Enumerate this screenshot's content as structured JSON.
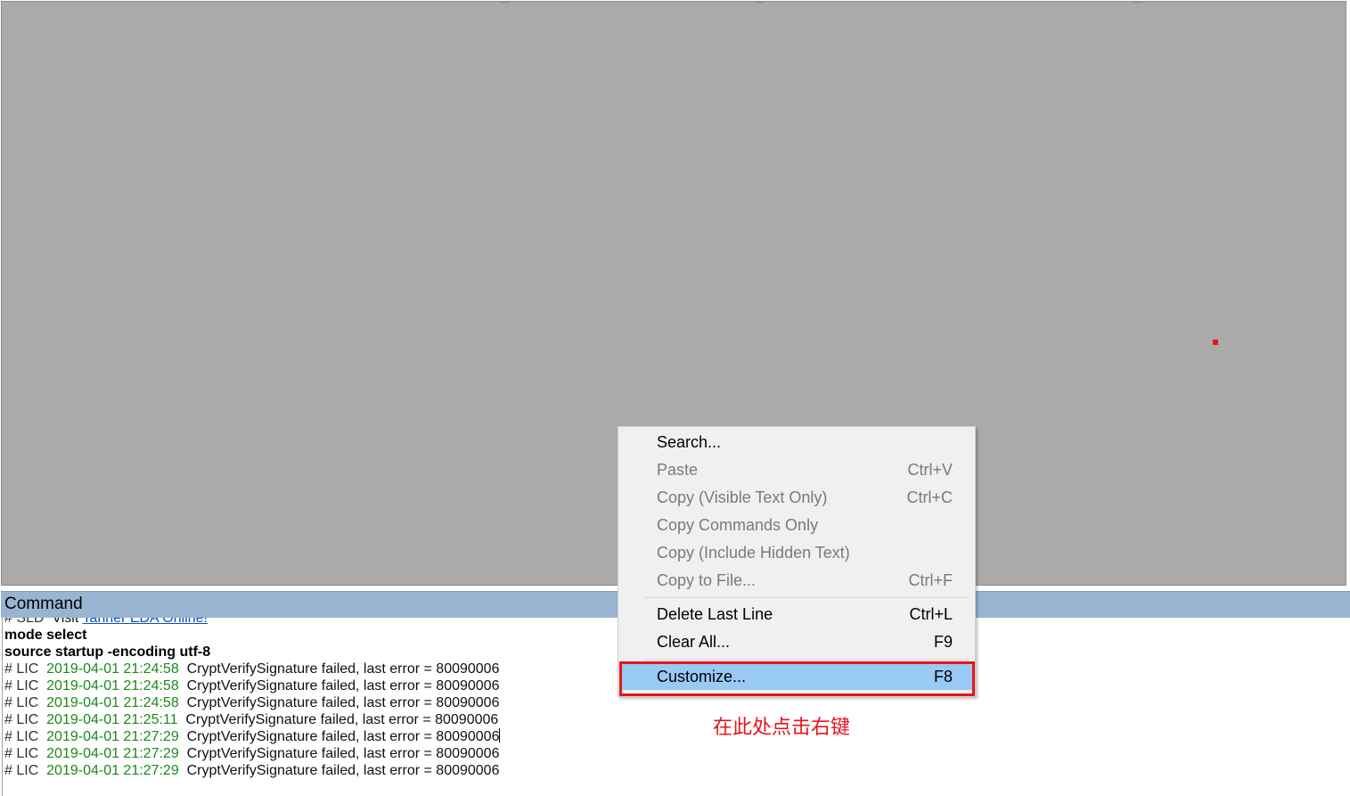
{
  "canvas": {
    "background_color": "#aaaaaa",
    "marker_color": "#e8141b"
  },
  "command_panel": {
    "title": "Command",
    "header_color": "#99b4d1"
  },
  "console": {
    "partial_line": {
      "prefix": "# SLD",
      "text": "Visit ",
      "link": "Tanner EDA Online!"
    },
    "commands": [
      "mode select",
      "source startup -encoding utf-8"
    ],
    "log_lines": [
      {
        "prefix": "# LIC",
        "timestamp": "2019-04-01 21:24:58",
        "message": "CryptVerifySignature failed, last error = 80090006"
      },
      {
        "prefix": "# LIC",
        "timestamp": "2019-04-01 21:24:58",
        "message": "CryptVerifySignature failed, last error = 80090006"
      },
      {
        "prefix": "# LIC",
        "timestamp": "2019-04-01 21:24:58",
        "message": "CryptVerifySignature failed, last error = 80090006"
      },
      {
        "prefix": "# LIC",
        "timestamp": "2019-04-01 21:25:11",
        "message": "CryptVerifySignature failed, last error = 80090006"
      },
      {
        "prefix": "# LIC",
        "timestamp": "2019-04-01 21:27:29",
        "message": "CryptVerifySignature failed, last error = 80090006"
      },
      {
        "prefix": "# LIC",
        "timestamp": "2019-04-01 21:27:29",
        "message": "CryptVerifySignature failed, last error = 80090006"
      },
      {
        "prefix": "# LIC",
        "timestamp": "2019-04-01 21:27:29",
        "message": "CryptVerifySignature failed, last error = 80090006"
      }
    ],
    "timestamp_color": "#1a8a1a",
    "link_color": "#0a4fbf"
  },
  "context_menu": {
    "items": [
      {
        "label": "Search...",
        "shortcut": "",
        "enabled": true
      },
      {
        "label": "Paste",
        "shortcut": "Ctrl+V",
        "enabled": false
      },
      {
        "label": "Copy (Visible Text Only)",
        "shortcut": "Ctrl+C",
        "enabled": false
      },
      {
        "label": "Copy Commands Only",
        "shortcut": "",
        "enabled": false
      },
      {
        "label": "Copy (Include Hidden Text)",
        "shortcut": "",
        "enabled": false
      },
      {
        "label": "Copy to File...",
        "shortcut": "Ctrl+F",
        "enabled": false
      },
      {
        "label": "Delete Last Line",
        "shortcut": "Ctrl+L",
        "enabled": true
      },
      {
        "label": "Clear All...",
        "shortcut": "F9",
        "enabled": true
      },
      {
        "label": "Customize...",
        "shortcut": "F8",
        "enabled": true,
        "highlighted": true
      }
    ],
    "highlight_color": "#99c9f5"
  },
  "annotation": {
    "note": "在此处点击右键",
    "color": "#e8141b"
  }
}
